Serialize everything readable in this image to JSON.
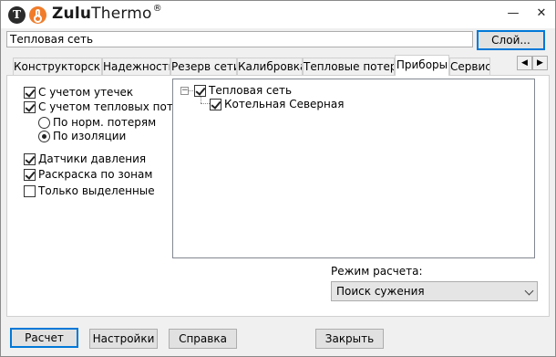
{
  "app": {
    "logo_letter": "T",
    "title_bold": "Zulu",
    "title_rest": "Thermo",
    "title_reg": "®"
  },
  "window_controls": {
    "minimize": "—",
    "close": "✕"
  },
  "path_field": {
    "value": "Тепловая сеть"
  },
  "layer_button": "Слой...",
  "tabs": [
    {
      "label": "Конструкторский"
    },
    {
      "label": "Надежность"
    },
    {
      "label": "Резерв сети"
    },
    {
      "label": "Калибровка"
    },
    {
      "label": "Тепловые потери"
    },
    {
      "label": "Приборы",
      "active": true
    },
    {
      "label": "Сервис"
    }
  ],
  "tab_scroll": {
    "left": "◀",
    "right": "▶"
  },
  "options": {
    "leaks": {
      "label": "С учетом утечек",
      "checked": true
    },
    "heat_losses": {
      "label": "С учетом тепловых потерь",
      "checked": true
    },
    "radio_norm": {
      "label": "По норм. потерям",
      "checked": false
    },
    "radio_insulation": {
      "label": "По изоляции",
      "checked": true
    },
    "pressure_sensors": {
      "label": "Датчики давления",
      "checked": true
    },
    "zone_coloring": {
      "label": "Раскраска по зонам",
      "checked": true
    },
    "selected_only": {
      "label": "Только выделенные",
      "checked": false
    }
  },
  "tree": {
    "expander": "−",
    "root": {
      "label": "Тепловая сеть",
      "checked": true
    },
    "child": {
      "label": "Котельная Северная",
      "checked": true
    }
  },
  "calc_mode": {
    "label": "Режим расчета:",
    "selected": "Поиск сужения"
  },
  "footer": {
    "calc": "Расчет",
    "settings": "Настройки",
    "help": "Справка",
    "close": "Закрыть"
  }
}
